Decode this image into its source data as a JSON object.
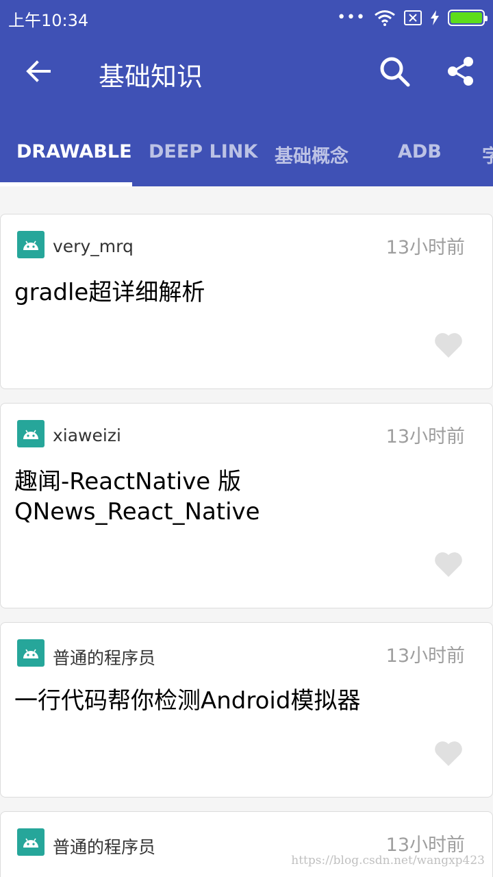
{
  "status_bar": {
    "time": "上午10:34",
    "dots": "•••"
  },
  "toolbar": {
    "title": "基础知识"
  },
  "tabs": [
    {
      "label": "DRAWABLE",
      "active": true
    },
    {
      "label": "DEEP LINK",
      "active": false
    },
    {
      "label": "基础概念",
      "active": false
    },
    {
      "label": "ADB",
      "active": false
    },
    {
      "label": "字",
      "active": false
    }
  ],
  "posts": [
    {
      "author": "very_mrq",
      "time": "13小时前",
      "title": "gradle超详细解析"
    },
    {
      "author": "xiaweizi",
      "time": "13小时前",
      "title_line1": "趣闻-ReactNative 版",
      "title_line2": "QNews_React_Native"
    },
    {
      "author": "普通的程序员",
      "time": "13小时前",
      "title": "一行代码帮你检测Android模拟器"
    },
    {
      "author": "普通的程序员",
      "time": "13小时前"
    }
  ],
  "watermark": "https://blog.csdn.net/wangxp423",
  "colors": {
    "primary": "#3f51b5",
    "battery": "#5ddd1b",
    "heart": "#e0e0e0",
    "avatar": "#26a69a"
  }
}
